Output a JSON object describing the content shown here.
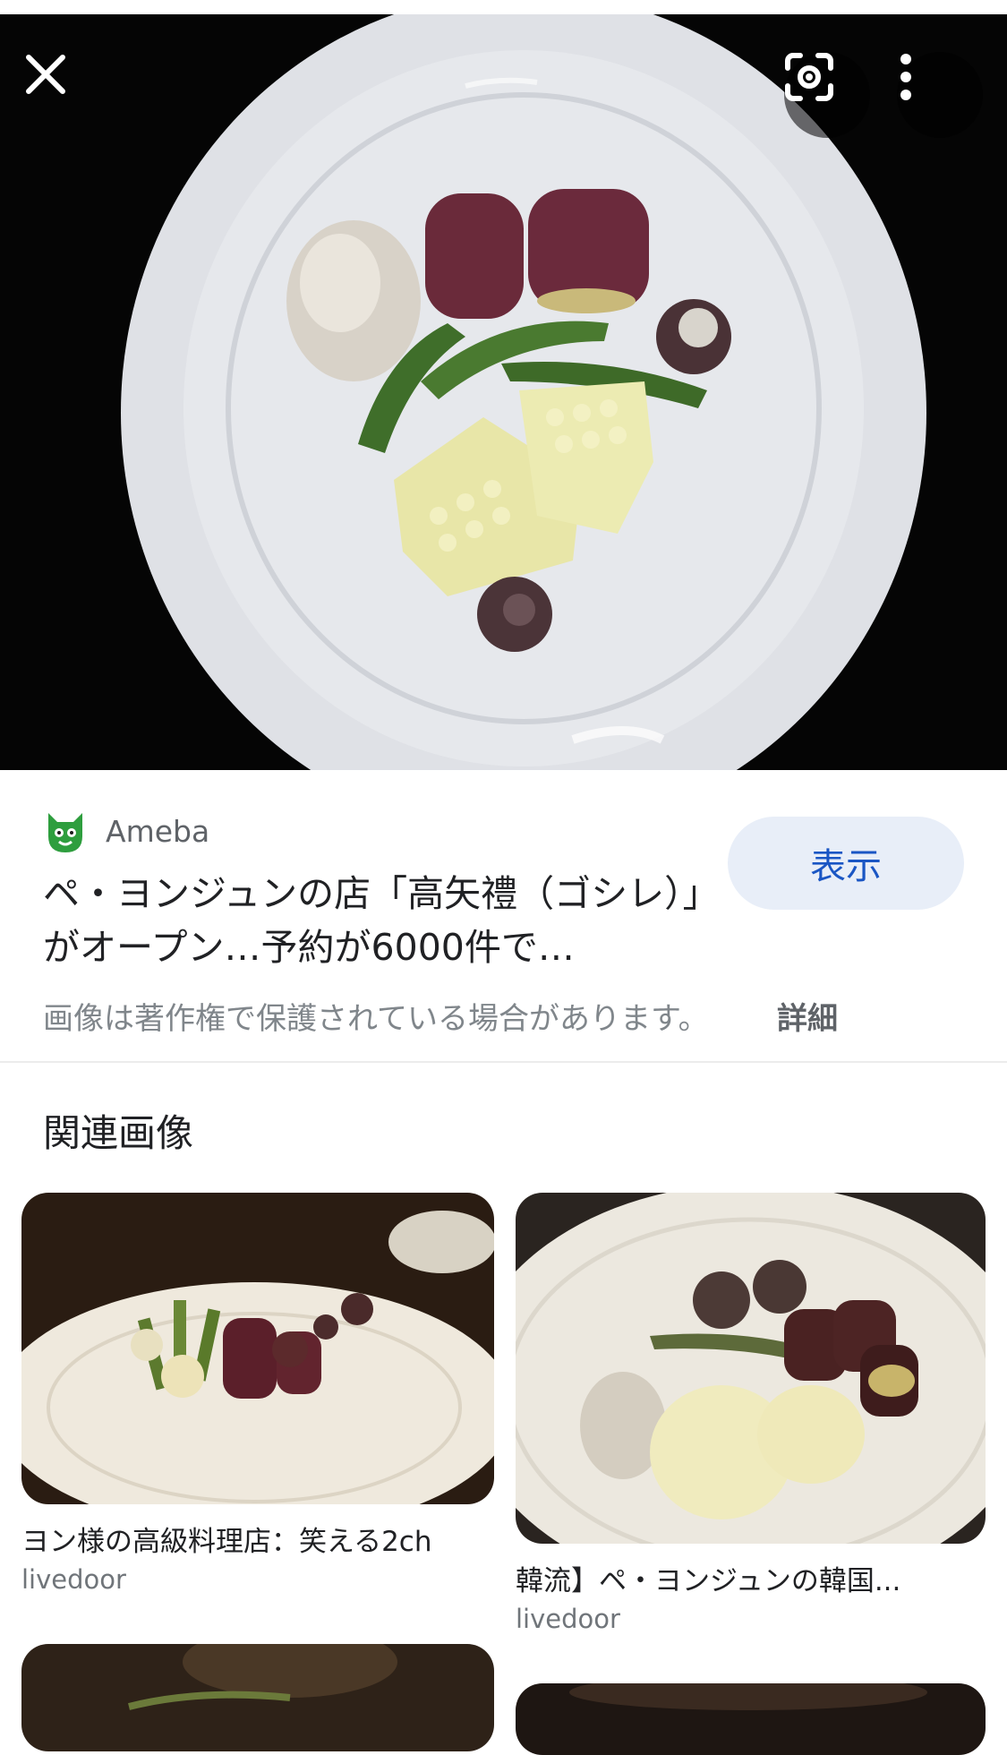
{
  "viewer": {
    "close_icon": "close-icon",
    "lens_icon": "google-lens-icon",
    "more_icon": "more-vert-icon"
  },
  "result": {
    "source_name": "Ameba",
    "source_logo": "ameba-logo-icon",
    "title": "ペ・ヨンジュンの店「高矢禮（ゴシレ）」がオープン…予約が6000件で…",
    "visit_label": "表示",
    "copyright_notice": "画像は著作権で保護されている場合があります。",
    "details_label": "詳細"
  },
  "related": {
    "heading": "関連画像",
    "items": [
      {
        "caption": "ヨン様の高級料理店：笑える2ch",
        "source": "livedoor"
      },
      {
        "caption": "韓流】ペ・ヨンジュンの韓国...",
        "source": "livedoor"
      }
    ]
  },
  "colors": {
    "visit_button_bg": "#e8eef8",
    "visit_button_text": "#1a56c4",
    "ameba_green": "#2e9e3e"
  }
}
